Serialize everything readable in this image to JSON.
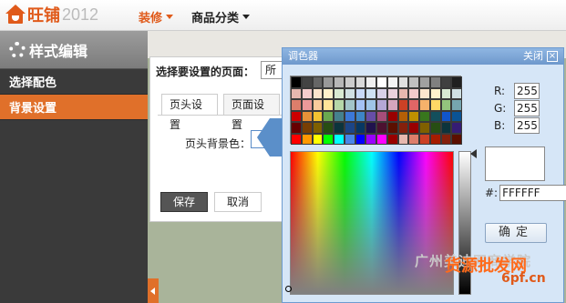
{
  "brand": {
    "name": "旺铺",
    "year": "2012"
  },
  "nav": [
    {
      "label": "装修",
      "active": true
    },
    {
      "label": "商品分类",
      "active": false
    }
  ],
  "sidebar": {
    "title": "样式编辑",
    "items": [
      {
        "label": "选择配色",
        "active": false
      },
      {
        "label": "背景设置",
        "active": true
      }
    ]
  },
  "panel": {
    "page_label": "选择要设置的页面：",
    "page_select": "所",
    "tabs": [
      "页头设置",
      "页面设置"
    ],
    "field_label": "页头背景色：",
    "save": "保存",
    "cancel": "取消"
  },
  "picker": {
    "title": "调色器",
    "close": "关闭",
    "r_label": "R:",
    "r": "255",
    "g_label": "G:",
    "g": "255",
    "b_label": "B:",
    "b": "255",
    "hex_label": "#:",
    "hex": "FFFFFF",
    "ok": "确定",
    "swatches": [
      "#000000",
      "#434343",
      "#666666",
      "#999999",
      "#b7b7b7",
      "#cccccc",
      "#d9d9d9",
      "#efefef",
      "#ffffff",
      "#f3f3f3",
      "#e0e0e0",
      "#c0c0c0",
      "#a0a0a0",
      "#808080",
      "#404040",
      "#202020",
      "#e6b8af",
      "#f4cccc",
      "#fce5cd",
      "#fff2cc",
      "#d9ead3",
      "#d0e0e3",
      "#c9daf8",
      "#cfe2f3",
      "#d9d2e9",
      "#ead1dc",
      "#e6b8af",
      "#f4cccc",
      "#fce5cd",
      "#fff2cc",
      "#d9ead3",
      "#d0e0e3",
      "#dd7e6b",
      "#ea9999",
      "#f9cb9c",
      "#ffe599",
      "#b6d7a8",
      "#a2c4c9",
      "#a4c2f4",
      "#9fc5e8",
      "#b4a7d6",
      "#d5a6bd",
      "#cc4125",
      "#e06666",
      "#f6b26b",
      "#ffd966",
      "#93c47d",
      "#76a5af",
      "#cc0000",
      "#e69138",
      "#f1c232",
      "#6aa84f",
      "#45818e",
      "#3c78d8",
      "#3d85c6",
      "#674ea7",
      "#a64d79",
      "#990000",
      "#b45f06",
      "#bf9000",
      "#38761d",
      "#134f5c",
      "#1155cc",
      "#0b5394",
      "#660000",
      "#783f04",
      "#7f6000",
      "#274e13",
      "#0c343d",
      "#1c4587",
      "#073763",
      "#20124d",
      "#4c1130",
      "#5b0f00",
      "#85200c",
      "#990000",
      "#7f6000",
      "#274e13",
      "#0c343d",
      "#351c75",
      "#ff0000",
      "#ff9900",
      "#ffff00",
      "#00ff00",
      "#00ffff",
      "#4a86e8",
      "#0000ff",
      "#9900ff",
      "#ff00ff",
      "#980000",
      "#e6b8af",
      "#dd7e6b",
      "#cc4125",
      "#a61c00",
      "#85200c",
      "#5b0f00"
    ]
  },
  "watermark": {
    "line1": "广州美迪网商学院",
    "line2": "货源批发网",
    "line3": "6pf.cn"
  }
}
